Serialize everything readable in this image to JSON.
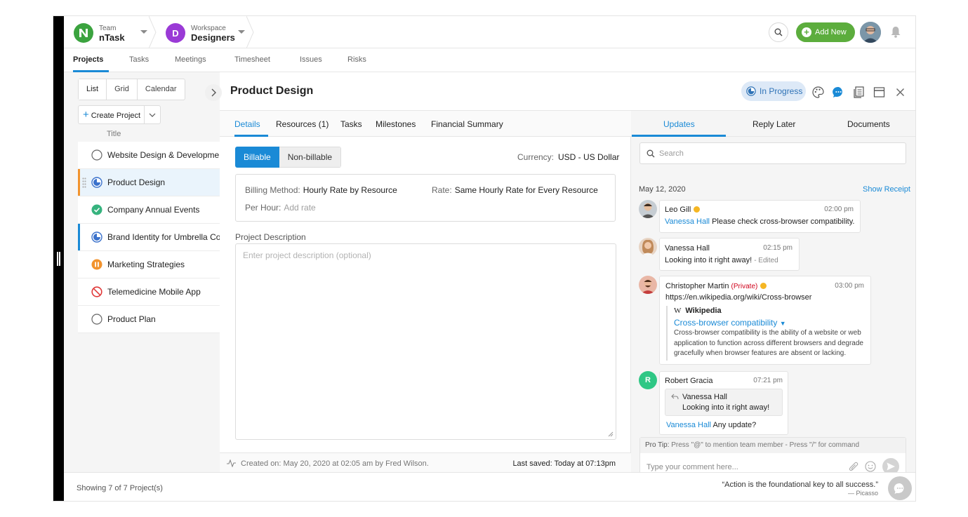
{
  "header": {
    "team_caption": "Team",
    "team_name": "nTask",
    "workspace_caption": "Workspace",
    "workspace_name": "Designers",
    "workspace_initial": "D",
    "add_new_label": "Add New",
    "colors": {
      "team": "#3ba33f",
      "workspace": "#9a3ad6",
      "add_new": "#5cad3d"
    }
  },
  "main_tabs": [
    "Projects",
    "Tasks",
    "Meetings",
    "Timesheet",
    "Issues",
    "Risks"
  ],
  "left_panel": {
    "view_options": [
      "List",
      "Grid",
      "Calendar"
    ],
    "create_label": "Create Project",
    "column_title": "Title",
    "projects": [
      {
        "name": "Website Design & Development",
        "status": "empty-circle-icon"
      },
      {
        "name": "Product Design",
        "status": "in-progress-icon"
      },
      {
        "name": "Company Annual Events",
        "status": "completed-icon"
      },
      {
        "name": "Brand Identity for Umbrella Corporation",
        "status": "in-progress-icon"
      },
      {
        "name": "Marketing Strategies",
        "status": "paused-icon"
      },
      {
        "name": "Telemedicine Mobile App",
        "status": "cancelled-icon"
      },
      {
        "name": "Product Plan",
        "status": "empty-circle-icon"
      }
    ]
  },
  "project": {
    "title": "Product Design",
    "status": "In Progress",
    "tabs": [
      "Details",
      "Resources (1)",
      "Tasks",
      "Milestones",
      "Financial Summary"
    ],
    "billing_options": [
      "Billable",
      "Non-billable"
    ],
    "currency_label": "Currency:",
    "currency_value": "USD - US Dollar",
    "billing_method_label": "Billing Method:",
    "billing_method_value": "Hourly Rate by Resource",
    "rate_label": "Rate:",
    "rate_value": "Same Hourly Rate for Every Resource",
    "per_hour_label": "Per Hour:",
    "per_hour_placeholder": "Add rate",
    "description_label": "Project Description",
    "description_placeholder": "Enter project description (optional)",
    "created_text": "Created on: May 20, 2020 at 02:05 am by Fred Wilson.",
    "saved_text": "Last saved: Today at 07:13pm"
  },
  "updates": {
    "tabs": [
      "Updates",
      "Reply Later",
      "Documents"
    ],
    "search_placeholder": "Search",
    "date": "May 12, 2020",
    "show_receipt": "Show Receipt",
    "messages": [
      {
        "author": "Leo Gill",
        "time": "02:00 pm",
        "mention": "Vanessa Hall",
        "text": "Please check cross-browser compatibility."
      },
      {
        "author": "Vanessa Hall",
        "time": "02:15 pm",
        "text": "Looking into it right away!",
        "edited": "- Edited"
      },
      {
        "author": "Christopher Martin",
        "private": "(Private)",
        "time": "03:00 pm",
        "text": "https://en.wikipedia.org/wiki/Cross-browser",
        "preview": {
          "source": "Wikipedia",
          "title": "Cross-browser compatibility",
          "lines": [
            "Cross-browser compatibility is the ability of a website or web",
            "application to function across different browsers and degrade",
            "gracefully when browser features are absent or lacking."
          ]
        }
      },
      {
        "author": "Robert Gracia",
        "initial": "R",
        "time": "07:21 pm",
        "quote_author": "Vanessa Hall",
        "quote_text": "Looking into it right away!",
        "mention": "Vanessa Hall",
        "text": "Any update?"
      }
    ],
    "pro_tip_label": "Pro Tip:",
    "pro_tip": "Press \"@\" to mention team member  -  Press \"/\" for command",
    "comment_placeholder": "Type your comment here..."
  },
  "footer": {
    "showing": "Showing 7 of 7 Project(s)",
    "quote": "“Action is the foundational key to all success.”",
    "quote_author": "— Picasso"
  }
}
